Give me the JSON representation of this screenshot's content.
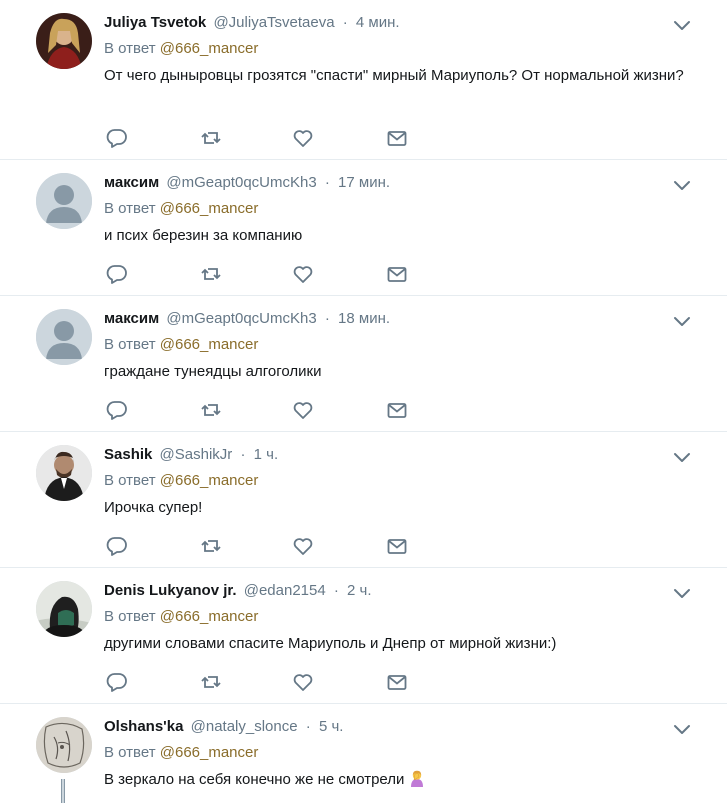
{
  "reply_prefix": "В ответ",
  "reply_handle": "@666_mancer",
  "tweets": [
    {
      "name": "Juliya Tsvetok",
      "handle": "@JuliyaTsvetaeva",
      "time": "4 мин.",
      "text": "От чего дыныровцы грозятся \"спасти\" мирный Мариуполь? От нормальной жизни?"
    },
    {
      "name": "максим",
      "handle": "@mGeapt0qcUmcKh3",
      "time": "17 мин.",
      "text": "и псих березин за компанию"
    },
    {
      "name": "максим",
      "handle": "@mGeapt0qcUmcKh3",
      "time": "18 мин.",
      "text": "граждане тунеядцы алгоголики"
    },
    {
      "name": "Sashik",
      "handle": "@SashikJr",
      "time": "1 ч.",
      "text": "Ирочка супер!"
    },
    {
      "name": "Denis Lukyanov jr.",
      "handle": "@edan2154",
      "time": "2 ч.",
      "text": "другими словами спасите Мариуполь и Днепр от мирной жизни:)"
    },
    {
      "name": "Olshans'ka",
      "handle": "@nataly_slonce",
      "time": "5 ч.",
      "text": "В зеркало на себя конечно же не смотрели"
    }
  ],
  "colors": {
    "icon": "#657786",
    "accent_handle": "#8a6d2b",
    "divider": "#e6ecf0"
  },
  "icons": [
    "reply-icon",
    "retweet-icon",
    "like-icon",
    "message-icon",
    "caret-down-icon",
    "facepalm-emoji-icon"
  ]
}
